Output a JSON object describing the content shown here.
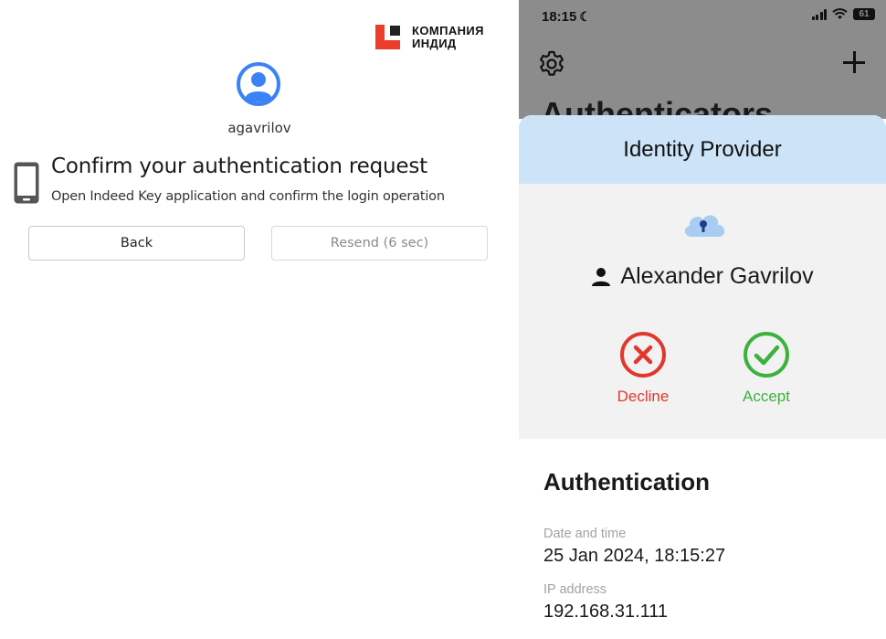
{
  "web": {
    "brand": {
      "line1": "КОМПАНИЯ",
      "line2": "ИНДИД"
    },
    "username": "agavrilov",
    "title": "Confirm your authentication request",
    "subtitle": "Open Indeed Key application and confirm the login operation",
    "back_label": "Back",
    "resend_label": "Resend (6 sec)"
  },
  "phone": {
    "status": {
      "time": "18:15",
      "battery": "61"
    },
    "background_title": "Authenticators",
    "sheet": {
      "header": "Identity Provider",
      "user_name": "Alexander Gavrilov",
      "decline_label": "Decline",
      "accept_label": "Accept"
    },
    "details": {
      "section_title": "Authentication",
      "date_label": "Date and time",
      "date_value": "25 Jan 2024, 18:15:27",
      "ip_label": "IP address",
      "ip_value": "192.168.31.111"
    }
  },
  "colors": {
    "brand_red": "#ea3d2a",
    "avatar_blue": "#3b82f6",
    "sheet_header": "#cde3f7",
    "decline_red": "#e0382d",
    "accept_green": "#3db13d"
  }
}
